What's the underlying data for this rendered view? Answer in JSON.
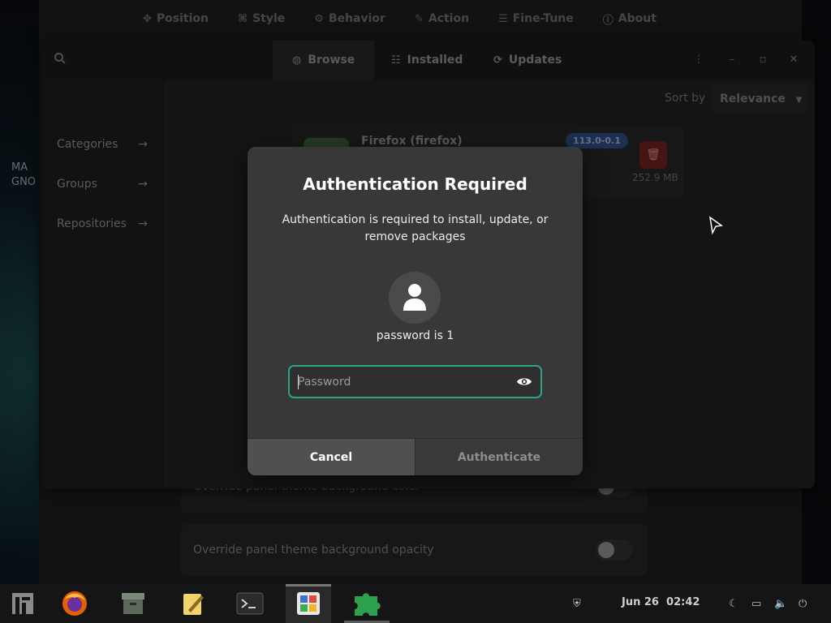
{
  "desktop": {
    "label_line1": "MA",
    "label_line2": "GNO"
  },
  "settings_window": {
    "tabs": [
      {
        "label": "Position",
        "icon": "crosshair-icon"
      },
      {
        "label": "Style",
        "icon": "palette-icon"
      },
      {
        "label": "Behavior",
        "icon": "gear-icon"
      },
      {
        "label": "Action",
        "icon": "pin-icon"
      },
      {
        "label": "Fine-Tune",
        "icon": "sliders-icon"
      },
      {
        "label": "About",
        "icon": "info-icon"
      }
    ],
    "rows": [
      {
        "label": "Override panel theme background color"
      },
      {
        "label": "Override panel theme background opacity"
      }
    ]
  },
  "software_window": {
    "tabs": [
      {
        "label": "Browse",
        "icon": "globe-icon",
        "active": true
      },
      {
        "label": "Installed",
        "icon": "list-icon",
        "active": false
      },
      {
        "label": "Updates",
        "icon": "refresh-icon",
        "active": false
      }
    ],
    "sidebar": [
      {
        "label": "Categories"
      },
      {
        "label": "Groups"
      },
      {
        "label": "Repositories"
      }
    ],
    "sort_label": "Sort by",
    "sort_value": "Relevance",
    "app": {
      "name": "Firefox (firefox)",
      "version": "113.0-0.1",
      "size": "252.9 MB"
    }
  },
  "dialog": {
    "title": "Authentication Required",
    "message": "Authentication is required to install, update, or remove packages",
    "user_label": "password is 1",
    "password_placeholder": "Password",
    "cancel_label": "Cancel",
    "authenticate_label": "Authenticate"
  },
  "taskbar": {
    "apps": [
      "app-menu-icon",
      "firefox-icon",
      "archive-icon",
      "text-editor-icon",
      "terminal-icon",
      "software-icon",
      "extensions-icon"
    ],
    "date": "Jun 26",
    "time": "02:42"
  },
  "colors": {
    "accent": "#2aa58a",
    "dialog_bg": "#383838",
    "version_badge": "#2a4a80",
    "delete_button": "#6a1f1f"
  }
}
